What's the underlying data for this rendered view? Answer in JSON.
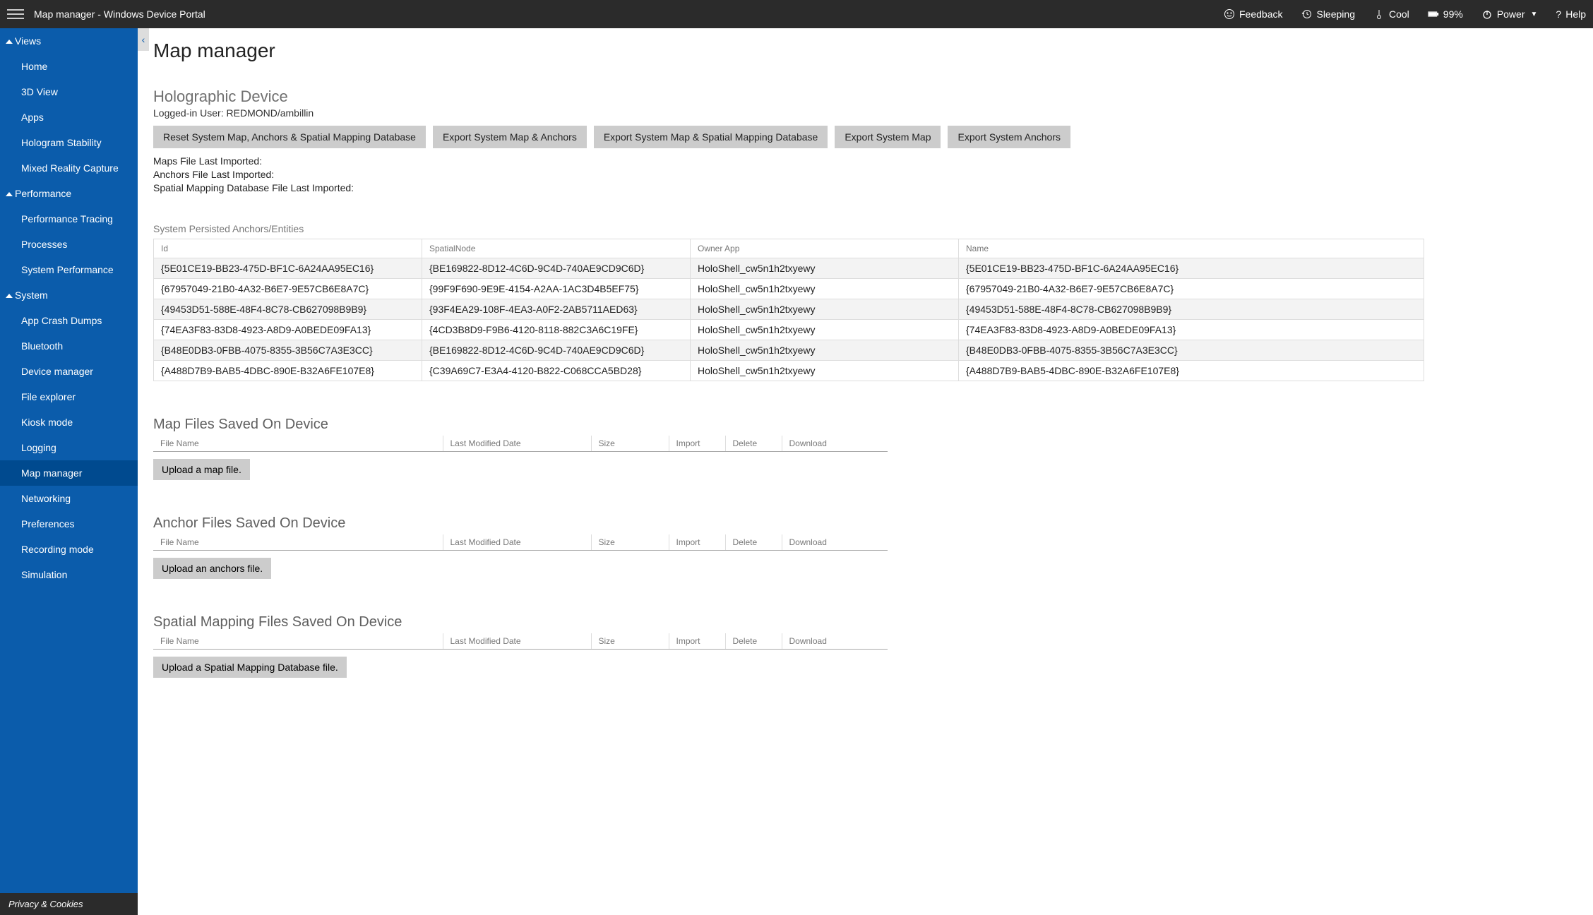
{
  "topbar": {
    "title": "Map manager - Windows Device Portal",
    "items": {
      "feedback": "Feedback",
      "sleeping": "Sleeping",
      "cool": "Cool",
      "battery": "99%",
      "power": "Power",
      "help": "Help"
    }
  },
  "sidebar": {
    "sections": [
      {
        "label": "Views",
        "items": [
          "Home",
          "3D View",
          "Apps",
          "Hologram Stability",
          "Mixed Reality Capture"
        ]
      },
      {
        "label": "Performance",
        "items": [
          "Performance Tracing",
          "Processes",
          "System Performance"
        ]
      },
      {
        "label": "System",
        "items": [
          "App Crash Dumps",
          "Bluetooth",
          "Device manager",
          "File explorer",
          "Kiosk mode",
          "Logging",
          "Map manager",
          "Networking",
          "Preferences",
          "Recording mode",
          "Simulation"
        ]
      }
    ],
    "active": "Map manager",
    "privacy": "Privacy & Cookies"
  },
  "main": {
    "page_title": "Map manager",
    "holo_title": "Holographic Device",
    "logged_in_prefix": "Logged-in User: ",
    "logged_in_user": "REDMOND/ambillin",
    "buttons": {
      "reset": "Reset System Map, Anchors & Spatial Mapping Database",
      "export_map_anchors": "Export System Map & Anchors",
      "export_map_smdb": "Export System Map & Spatial Mapping Database",
      "export_map": "Export System Map",
      "export_anchors": "Export System Anchors"
    },
    "info_lines": {
      "maps": "Maps File Last Imported:",
      "anchors": "Anchors File Last Imported:",
      "smdb": "Spatial Mapping Database File Last Imported:"
    },
    "anchors_title": "System Persisted Anchors/Entities",
    "anchors_headers": {
      "id": "Id",
      "spatial": "SpatialNode",
      "owner": "Owner App",
      "name": "Name"
    },
    "anchors_rows": [
      {
        "id": "{5E01CE19-BB23-475D-BF1C-6A24AA95EC16}",
        "spatial": "{BE169822-8D12-4C6D-9C4D-740AE9CD9C6D}",
        "owner": "HoloShell_cw5n1h2txyewy",
        "name": "{5E01CE19-BB23-475D-BF1C-6A24AA95EC16}"
      },
      {
        "id": "{67957049-21B0-4A32-B6E7-9E57CB6E8A7C}",
        "spatial": "{99F9F690-9E9E-4154-A2AA-1AC3D4B5EF75}",
        "owner": "HoloShell_cw5n1h2txyewy",
        "name": "{67957049-21B0-4A32-B6E7-9E57CB6E8A7C}"
      },
      {
        "id": "{49453D51-588E-48F4-8C78-CB627098B9B9}",
        "spatial": "{93F4EA29-108F-4EA3-A0F2-2AB5711AED63}",
        "owner": "HoloShell_cw5n1h2txyewy",
        "name": "{49453D51-588E-48F4-8C78-CB627098B9B9}"
      },
      {
        "id": "{74EA3F83-83D8-4923-A8D9-A0BEDE09FA13}",
        "spatial": "{4CD3B8D9-F9B6-4120-8118-882C3A6C19FE}",
        "owner": "HoloShell_cw5n1h2txyewy",
        "name": "{74EA3F83-83D8-4923-A8D9-A0BEDE09FA13}"
      },
      {
        "id": "{B48E0DB3-0FBB-4075-8355-3B56C7A3E3CC}",
        "spatial": "{BE169822-8D12-4C6D-9C4D-740AE9CD9C6D}",
        "owner": "HoloShell_cw5n1h2txyewy",
        "name": "{B48E0DB3-0FBB-4075-8355-3B56C7A3E3CC}"
      },
      {
        "id": "{A488D7B9-BAB5-4DBC-890E-B32A6FE107E8}",
        "spatial": "{C39A69C7-E3A4-4120-B822-C068CCA5BD28}",
        "owner": "HoloShell_cw5n1h2txyewy",
        "name": "{A488D7B9-BAB5-4DBC-890E-B32A6FE107E8}"
      }
    ],
    "file_tables": {
      "headers": {
        "fname": "File Name",
        "lmd": "Last Modified Date",
        "size": "Size",
        "import": "Import",
        "delete": "Delete",
        "download": "Download"
      },
      "map_title": "Map Files Saved On Device",
      "map_upload": "Upload a map file.",
      "anchor_title": "Anchor Files Saved On Device",
      "anchor_upload": "Upload an anchors file.",
      "smdb_title": "Spatial Mapping Files Saved On Device",
      "smdb_upload": "Upload a Spatial Mapping Database file."
    }
  }
}
